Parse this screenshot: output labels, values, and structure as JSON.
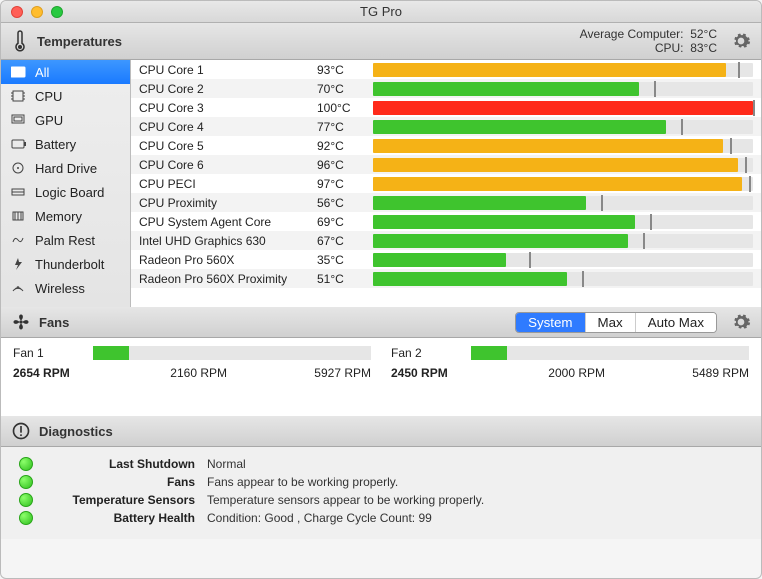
{
  "window": {
    "title": "TG Pro"
  },
  "temps_header": {
    "title": "Temperatures",
    "avg_computer_label": "Average Computer:",
    "avg_computer_val": "52°C",
    "cpu_label": "CPU:",
    "cpu_val": "83°C"
  },
  "sidebar": {
    "items": [
      {
        "label": "All",
        "active": true
      },
      {
        "label": "CPU",
        "active": false
      },
      {
        "label": "GPU",
        "active": false
      },
      {
        "label": "Battery",
        "active": false
      },
      {
        "label": "Hard Drive",
        "active": false
      },
      {
        "label": "Logic Board",
        "active": false
      },
      {
        "label": "Memory",
        "active": false
      },
      {
        "label": "Palm Rest",
        "active": false
      },
      {
        "label": "Thunderbolt",
        "active": false
      },
      {
        "label": "Wireless",
        "active": false
      }
    ]
  },
  "sensors": [
    {
      "name": "CPU Core 1",
      "val": "93°C",
      "pct": 93,
      "color": "orange",
      "tick": 96
    },
    {
      "name": "CPU Core 2",
      "val": "70°C",
      "pct": 70,
      "color": "green",
      "tick": 74
    },
    {
      "name": "CPU Core 3",
      "val": "100°C",
      "pct": 100,
      "color": "red",
      "tick": 100
    },
    {
      "name": "CPU Core 4",
      "val": "77°C",
      "pct": 77,
      "color": "green",
      "tick": 81
    },
    {
      "name": "CPU Core 5",
      "val": "92°C",
      "pct": 92,
      "color": "orange",
      "tick": 94
    },
    {
      "name": "CPU Core 6",
      "val": "96°C",
      "pct": 96,
      "color": "orange",
      "tick": 98
    },
    {
      "name": "CPU PECI",
      "val": "97°C",
      "pct": 97,
      "color": "orange",
      "tick": 99
    },
    {
      "name": "CPU Proximity",
      "val": "56°C",
      "pct": 56,
      "color": "green",
      "tick": 60
    },
    {
      "name": "CPU System Agent Core",
      "val": "69°C",
      "pct": 69,
      "color": "green",
      "tick": 73
    },
    {
      "name": "Intel UHD Graphics 630",
      "val": "67°C",
      "pct": 67,
      "color": "green",
      "tick": 71
    },
    {
      "name": "Radeon Pro 560X",
      "val": "35°C",
      "pct": 35,
      "color": "green",
      "tick": 41
    },
    {
      "name": "Radeon Pro 560X Proximity",
      "val": "51°C",
      "pct": 51,
      "color": "green",
      "tick": 55
    }
  ],
  "fans_header": {
    "title": "Fans",
    "seg": {
      "system": "System",
      "max": "Max",
      "automax": "Auto Max"
    }
  },
  "fans": [
    {
      "name": "Fan 1",
      "cur": "2654 RPM",
      "min": "2160 RPM",
      "max": "5927 RPM",
      "pct": 13
    },
    {
      "name": "Fan 2",
      "cur": "2450 RPM",
      "min": "2000 RPM",
      "max": "5489 RPM",
      "pct": 13
    }
  ],
  "diag_header": {
    "title": "Diagnostics"
  },
  "diagnostics": [
    {
      "label": "Last Shutdown",
      "val": "Normal"
    },
    {
      "label": "Fans",
      "val": "Fans appear to be working properly."
    },
    {
      "label": "Temperature Sensors",
      "val": "Temperature sensors appear to be working properly."
    },
    {
      "label": "Battery Health",
      "val": "Condition: Good , Charge Cycle Count: 99"
    }
  ]
}
